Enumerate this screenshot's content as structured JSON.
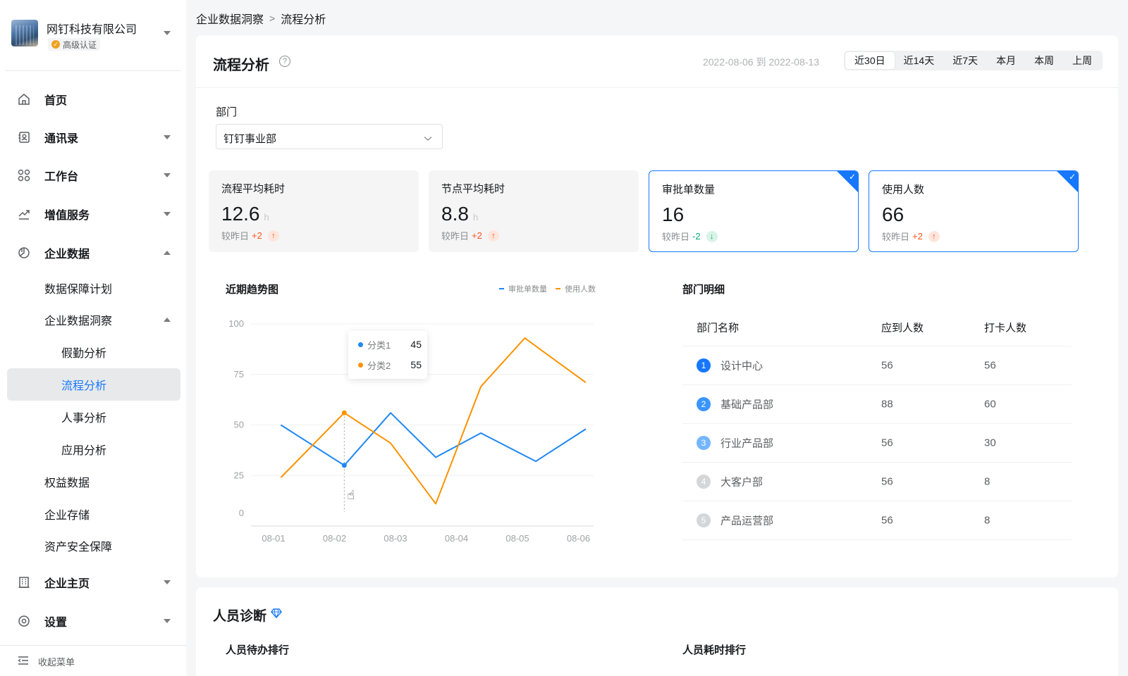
{
  "org": {
    "name": "网钉科技有限公司",
    "badge": "高级认证"
  },
  "nav": {
    "home": "首页",
    "contacts": "通讯录",
    "workbench": "工作台",
    "value_added": "增值服务",
    "enterprise_data": "企业数据",
    "data_plan": "数据保障计划",
    "insight": "企业数据洞察",
    "attendance": "假勤分析",
    "process": "流程分析",
    "hr": "人事分析",
    "app": "应用分析",
    "benefits": "权益数据",
    "storage": "企业存储",
    "asset_security": "资产安全保障",
    "homepage": "企业主页",
    "settings": "设置",
    "collapse": "收起菜单"
  },
  "breadcrumb": {
    "root": "企业数据洞察",
    "sep": ">",
    "current": "流程分析"
  },
  "header": {
    "title": "流程分析",
    "help": "?",
    "date_range": "2022-08-06 到 2022-08-13",
    "ranges": [
      "近30日",
      "近14天",
      "近7天",
      "本月",
      "本周",
      "上周"
    ],
    "active_range": "近30日"
  },
  "department": {
    "label": "部门",
    "value": "钉钉事业部"
  },
  "metrics": [
    {
      "title": "流程平均耗时",
      "value": "12.6",
      "unit": "h",
      "compare": "较昨日",
      "delta": "+2",
      "dir": "up",
      "selected": false
    },
    {
      "title": "节点平均耗时",
      "value": "8.8",
      "unit": "h",
      "compare": "较昨日",
      "delta": "+2",
      "dir": "up",
      "selected": false
    },
    {
      "title": "审批单数量",
      "value": "16",
      "unit": "",
      "compare": "较昨日",
      "delta": "-2",
      "dir": "down",
      "selected": true
    },
    {
      "title": "使用人数",
      "value": "66",
      "unit": "",
      "compare": "较昨日",
      "delta": "+2",
      "dir": "up",
      "selected": true
    }
  ],
  "chart_title": "近期趋势图",
  "chart_data": {
    "type": "line",
    "x": [
      "08-01",
      "08-02",
      "08-03",
      "08-04",
      "08-05",
      "08-06"
    ],
    "ylim": [
      0,
      100
    ],
    "yticks": [
      0,
      25,
      50,
      75,
      100
    ],
    "grid": true,
    "legend_position": "top-right",
    "series": [
      {
        "name": "审批单数量",
        "color": "#1e88f5",
        "points": [
          [
            0.12,
            50
          ],
          [
            1.16,
            30
          ],
          [
            1.92,
            56
          ],
          [
            2.66,
            34
          ],
          [
            3.4,
            46
          ],
          [
            4.3,
            32
          ],
          [
            5.12,
            48
          ]
        ]
      },
      {
        "name": "使用人数",
        "color": "#ff9200",
        "points": [
          [
            0.12,
            24
          ],
          [
            1.16,
            56
          ],
          [
            1.92,
            41
          ],
          [
            2.66,
            11
          ],
          [
            3.4,
            69
          ],
          [
            4.12,
            93
          ],
          [
            5.12,
            71
          ]
        ]
      }
    ],
    "tooltip": {
      "x_index": 1,
      "rows": [
        {
          "label": "分类1",
          "value": "45",
          "color": "#1e88f5"
        },
        {
          "label": "分类2",
          "value": "55",
          "color": "#ff9200"
        }
      ]
    }
  },
  "dept_table": {
    "title": "部门明细",
    "headers": [
      "部门名称",
      "应到人数",
      "打卡人数"
    ],
    "rows": [
      {
        "rank": "1",
        "name": "设计中心",
        "expected": "56",
        "checked": "56",
        "color": "#1677ff"
      },
      {
        "rank": "2",
        "name": "基础产品部",
        "expected": "88",
        "checked": "60",
        "color": "#3a95ff"
      },
      {
        "rank": "3",
        "name": "行业产品部",
        "expected": "56",
        "checked": "30",
        "color": "#74b5ff"
      },
      {
        "rank": "4",
        "name": "大客户部",
        "expected": "56",
        "checked": "8",
        "color": "#d4d6d8"
      },
      {
        "rank": "5",
        "name": "产品运营部",
        "expected": "56",
        "checked": "8",
        "color": "#d4d6d8"
      }
    ]
  },
  "diagnosis": {
    "title": "人员诊断",
    "todo_rank": "人员待办排行",
    "time_rank": "人员耗时排行"
  }
}
